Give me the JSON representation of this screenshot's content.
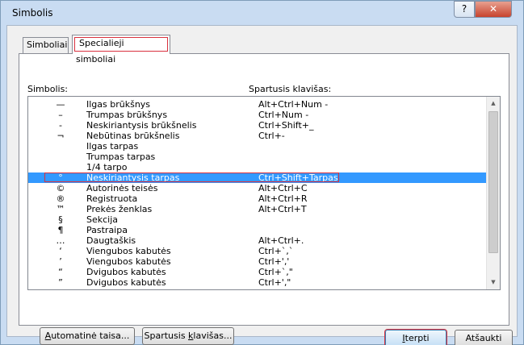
{
  "window": {
    "title": "Simbolis",
    "help": "?",
    "close": "✕"
  },
  "tabs": [
    {
      "label": "Simboliai",
      "active": false
    },
    {
      "label": "Specialieji simboliai",
      "active": true
    }
  ],
  "columns": {
    "symbol": "Simbolis:",
    "shortcut": "Spartusis klavišas:"
  },
  "rows": [
    {
      "sym": "—",
      "name": "Ilgas brūkšnys",
      "key": "Alt+Ctrl+Num -"
    },
    {
      "sym": "–",
      "name": "Trumpas brūkšnys",
      "key": "Ctrl+Num -"
    },
    {
      "sym": "-",
      "name": "Neskiriantysis brūkšnelis",
      "key": "Ctrl+Shift+_"
    },
    {
      "sym": "¬",
      "name": "Nebūtinas brūkšnelis",
      "key": "Ctrl+-"
    },
    {
      "sym": "",
      "name": "Ilgas tarpas",
      "key": ""
    },
    {
      "sym": "",
      "name": "Trumpas tarpas",
      "key": ""
    },
    {
      "sym": "",
      "name": "1/4 tarpo",
      "key": ""
    },
    {
      "sym": "°",
      "name": "Neskiriantysis tarpas",
      "key": "Ctrl+Shift+Tarpas",
      "selected": true
    },
    {
      "sym": "©",
      "name": "Autorinės teisės",
      "key": "Alt+Ctrl+C"
    },
    {
      "sym": "®",
      "name": "Registruota",
      "key": "Alt+Ctrl+R"
    },
    {
      "sym": "™",
      "name": "Prekės ženklas",
      "key": "Alt+Ctrl+T"
    },
    {
      "sym": "§",
      "name": "Sekcija",
      "key": ""
    },
    {
      "sym": "¶",
      "name": "Pastraipa",
      "key": ""
    },
    {
      "sym": "…",
      "name": "Daugtaškis",
      "key": "Alt+Ctrl+."
    },
    {
      "sym": "‘",
      "name": "Viengubos kabutės",
      "key": "Ctrl+`,`"
    },
    {
      "sym": "’",
      "name": "Viengubos kabutės",
      "key": "Ctrl+',' "
    },
    {
      "sym": "“",
      "name": "Dvigubos kabutės",
      "key": "Ctrl+`,\""
    },
    {
      "sym": "”",
      "name": "Dvigubos kabutės",
      "key": "Ctrl+',\""
    }
  ],
  "scrollbar": {
    "up": "▲",
    "down": "▼"
  },
  "buttons": {
    "auto_u": "A",
    "auto_rest": "utomatinė taisa...",
    "short_pre": "Spartusis ",
    "short_u": "k",
    "short_rest": "lavišas...",
    "insert_u": "I",
    "insert_rest": "terpti",
    "cancel": "Atšaukti"
  }
}
